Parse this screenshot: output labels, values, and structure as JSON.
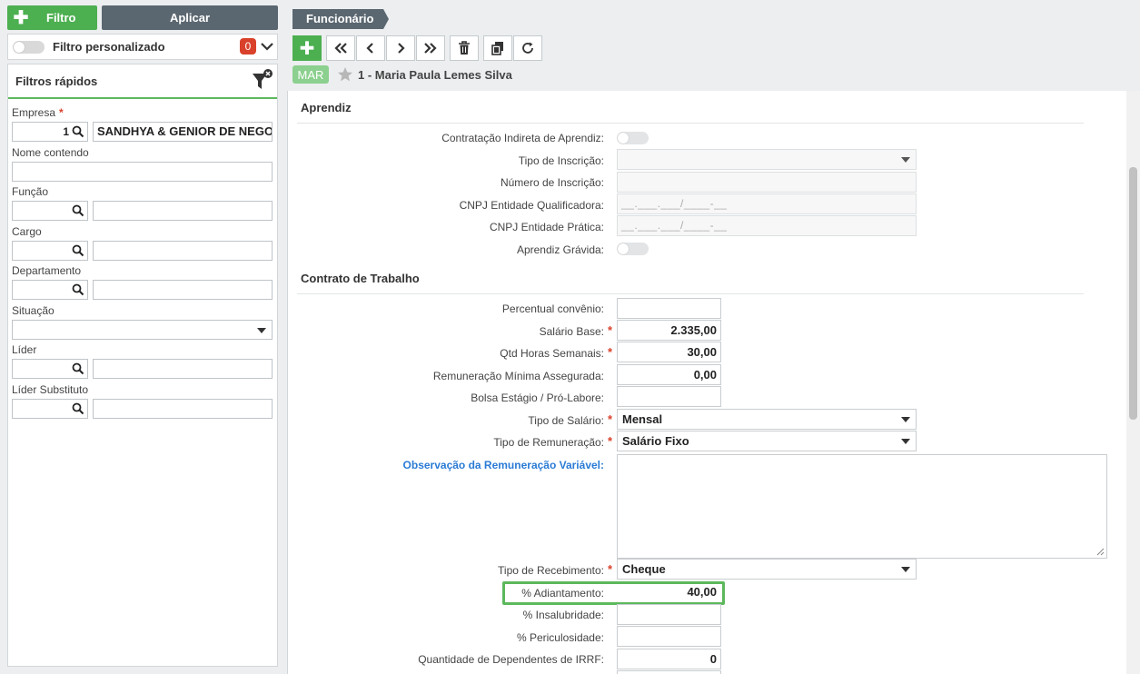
{
  "left": {
    "filter_button": "Filtro",
    "apply_button": "Aplicar",
    "custom_filter_label": "Filtro personalizado",
    "custom_filter_count": "0",
    "quick_filters_title": "Filtros rápidos",
    "fields": {
      "empresa_label": "Empresa",
      "empresa_code": "1",
      "empresa_name": "SANDHYA & GENIOR DE NEGOCIOS",
      "nome_label": "Nome contendo",
      "funcao_label": "Função",
      "cargo_label": "Cargo",
      "departamento_label": "Departamento",
      "situacao_label": "Situação",
      "lider_label": "Líder",
      "lider_sub_label": "Líder Substituto"
    }
  },
  "header": {
    "breadcrumb": "Funcionário",
    "record_tag": "MAR",
    "record_name": "1 - Maria Paula Lemes Silva"
  },
  "aprendiz": {
    "title": "Aprendiz",
    "contratacao_indireta": "Contratação Indireta de Aprendiz:",
    "tipo_inscricao": "Tipo de Inscrição:",
    "numero_inscricao": "Número de Inscrição:",
    "cnpj_qualificadora": "CNPJ Entidade Qualificadora:",
    "cnpj_pratica": "CNPJ Entidade Prática:",
    "aprendiz_gravida": "Aprendiz Grávida:",
    "cnpj_mask": "__.___.___/____-__"
  },
  "contrato": {
    "title": "Contrato de Trabalho",
    "percentual_convenio": "Percentual convênio:",
    "salario_base_label": "Salário Base:",
    "salario_base_value": "2.335,00",
    "qtd_horas_label": "Qtd Horas Semanais:",
    "qtd_horas_value": "30,00",
    "remuneracao_minima_label": "Remuneração Mínima Assegurada:",
    "remuneracao_minima_value": "0,00",
    "bolsa_estagio_label": "Bolsa Estágio / Pró-Labore:",
    "tipo_salario_label": "Tipo de Salário:",
    "tipo_salario_value": "Mensal",
    "tipo_remuneracao_label": "Tipo de Remuneração:",
    "tipo_remuneracao_value": "Salário Fixo",
    "observacao_label": "Observação da Remuneração Variável:",
    "tipo_recebimento_label": "Tipo de Recebimento:",
    "tipo_recebimento_value": "Cheque",
    "adiantamento_label": "% Adiantamento:",
    "adiantamento_value": "40,00",
    "insalubridade_label": "% Insalubridade:",
    "periculosidade_label": "% Periculosidade:",
    "dependentes_irrf_label": "Quantidade de Dependentes de IRRF:",
    "dependentes_irrf_value": "0"
  },
  "colors": {
    "accent_green": "#4caf50",
    "dark_slate": "#5b6770",
    "required_red": "#d9412b",
    "link_blue": "#2a7bd5"
  }
}
